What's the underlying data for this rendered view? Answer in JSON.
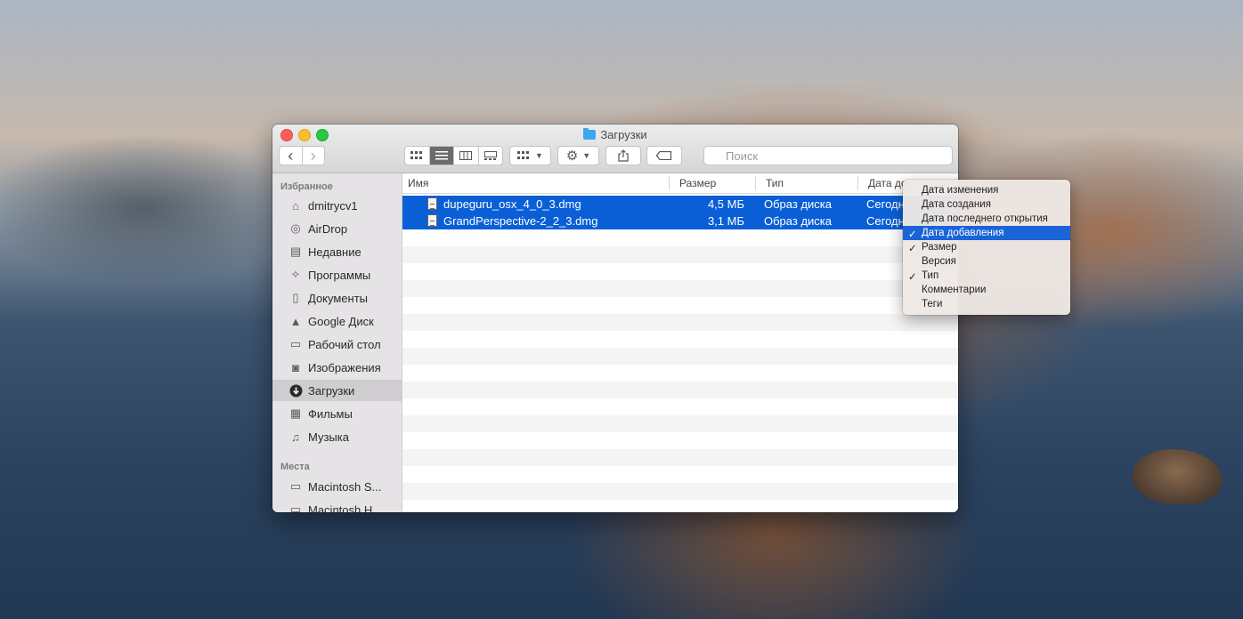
{
  "window": {
    "title": "Загрузки"
  },
  "toolbar": {
    "back": "‹",
    "forward": "›",
    "search_placeholder": "Поиск"
  },
  "sidebar": {
    "favorites_header": "Избранное",
    "items": [
      {
        "label": "dmitrycv1",
        "icon": "home-icon"
      },
      {
        "label": "AirDrop",
        "icon": "airdrop-icon"
      },
      {
        "label": "Недавние",
        "icon": "recent-icon"
      },
      {
        "label": "Программы",
        "icon": "applications-icon"
      },
      {
        "label": "Документы",
        "icon": "documents-icon"
      },
      {
        "label": "Google Диск",
        "icon": "google-drive-icon"
      },
      {
        "label": "Рабочий стол",
        "icon": "desktop-icon"
      },
      {
        "label": "Изображения",
        "icon": "camera-icon"
      },
      {
        "label": "Загрузки",
        "icon": "downloads-icon"
      },
      {
        "label": "Фильмы",
        "icon": "film-icon"
      },
      {
        "label": "Музыка",
        "icon": "music-icon"
      }
    ],
    "locations_header": "Места",
    "locations": [
      {
        "label": "Macintosh S...",
        "icon": "disk-icon"
      },
      {
        "label": "Macintosh H...",
        "icon": "disk-icon"
      }
    ]
  },
  "columns": {
    "name": "Имя",
    "size": "Размер",
    "type": "Тип",
    "date": "Дата до"
  },
  "files": [
    {
      "name": "dupeguru_osx_4_0_3.dmg",
      "size": "4,5 МБ",
      "type": "Образ диска",
      "date": "Сегодн"
    },
    {
      "name": "GrandPerspective-2_2_3.dmg",
      "size": "3,1 МБ",
      "type": "Образ диска",
      "date": "Сегодн"
    }
  ],
  "context_menu": {
    "items": [
      {
        "label": "Дата изменения",
        "checked": false
      },
      {
        "label": "Дата создания",
        "checked": false
      },
      {
        "label": "Дата последнего открытия",
        "checked": false
      },
      {
        "label": "Дата добавления",
        "checked": true,
        "highlighted": true
      },
      {
        "label": "Размер",
        "checked": true
      },
      {
        "label": "Версия",
        "checked": false
      },
      {
        "label": "Тип",
        "checked": true
      },
      {
        "label": "Комментарии",
        "checked": false
      },
      {
        "label": "Теги",
        "checked": false
      }
    ],
    "check_glyph": "✓"
  },
  "colors": {
    "selection": "#0a5fd6",
    "menu_highlight": "#1a64d8",
    "folder": "#39a8ef"
  }
}
